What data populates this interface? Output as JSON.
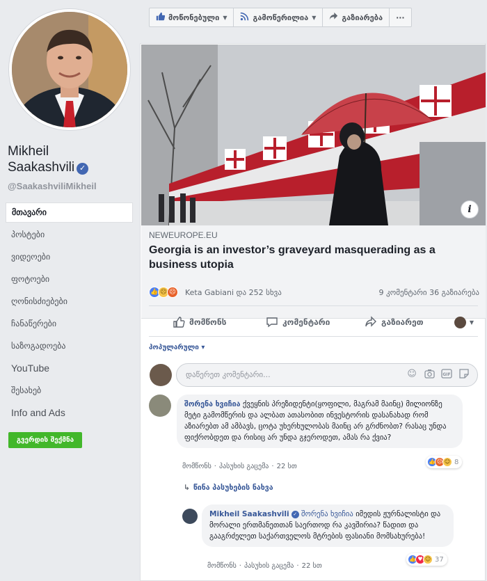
{
  "profile": {
    "name_line1": "Mikheil",
    "name_line2": "Saakashvili",
    "verified_glyph": "✓",
    "handle": "@SaakashviliMikheil"
  },
  "sidebar": {
    "items": [
      {
        "label": "მთავარი",
        "active": true
      },
      {
        "label": "პოსტები"
      },
      {
        "label": "ვიდეოები"
      },
      {
        "label": "ფოტოები"
      },
      {
        "label": "ღონისძიებები"
      },
      {
        "label": "ჩანაწერები"
      },
      {
        "label": "საზოგადოება"
      },
      {
        "label": "YouTube"
      },
      {
        "label": "შესახებ"
      },
      {
        "label": "Info and Ads"
      }
    ],
    "create_page_label": "გვერდის შექმნა"
  },
  "action_bar": {
    "like_label": "მოწონებული",
    "follow_label": "გამოწერილია",
    "share_label": "გაზიარება",
    "more_label": "···"
  },
  "post": {
    "info_glyph": "i",
    "link_domain": "NEWEUROPE.EU",
    "link_title": "Georgia is an investor’s graveyard masquerading as a business utopia",
    "reaction_names": "Keta Gabiani და 252 სხვა",
    "counts": "9 კომენტარი  36 გაზიარება",
    "like_btn": "მომწონს",
    "comment_btn": "კომენტარი",
    "share_btn": "გაზიარეთ",
    "sort_label": "პოპულარული",
    "comment_placeholder": "დაწერეთ კომენტარი..."
  },
  "comments": [
    {
      "author": "შორენა ხვიჩია",
      "text": "ქვეყნის პრეზიდენტი(ყოფილი, მაგრამ მაინც) მილიონზე მეტი გამომწერის და ალბათ ათასობით ინვესტორის დასანახად რომ აზიარებთ ამ ამბავს, ცოტა უხერხულობას მაინც არ გრძნობთ? რასაც უნდა ფიქრობდეთ და რისიც არ უნდა გჯეროდეთ, ამას რა ქვია?",
      "like": "მომწონს",
      "reply": "პასუხის გაცემა",
      "time": "22 სთ",
      "reaction_count": "8"
    },
    {
      "author": "Mikheil Saakashvili",
      "text_mention": "შორენა ხვიჩია",
      "text": "იმედის ჟურნალისტი და მორალი ერთმანეთთან საერთოდ რა კავშირია? წადით და გააგრძელეთ საქართველოს მტრების ფასიანი მომსახურება!",
      "like": "მომწონს",
      "reply": "პასუხის გაცემა",
      "time": "22 სთ",
      "reaction_count": "37"
    }
  ],
  "view_previous_replies": "წინა პასუხების ნახვა",
  "colors": {
    "accent": "#4267b2",
    "link": "#385898",
    "create_button": "#42b72a",
    "background": "#e9ebee"
  },
  "icons": [
    "thumbs-up-icon",
    "rss-icon",
    "share-arrow-icon",
    "comment-icon",
    "smiley-icon",
    "camera-icon",
    "gif-icon",
    "sticker-icon",
    "info-icon",
    "chevron-down-icon",
    "reply-arrow-icon"
  ]
}
